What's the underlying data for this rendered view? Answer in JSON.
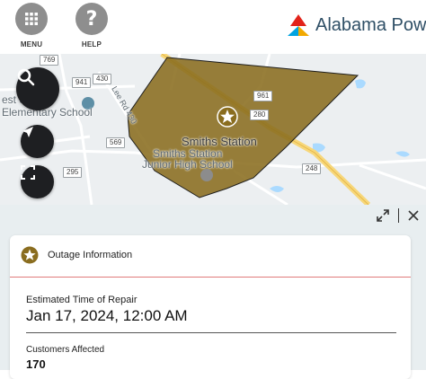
{
  "header": {
    "menu_label": "MENU",
    "help_label": "HELP",
    "help_glyph": "?",
    "brand_name": "Alabama Power",
    "brand_colors": {
      "red": "#e2231a",
      "blue": "#00a3e0",
      "dark": "#2f4f66"
    }
  },
  "map": {
    "places": {
      "school_west_1": "est S",
      "school_west_2": "Elementary School",
      "town": "Smiths Station",
      "jhs_1": "Smiths Station",
      "jhs_2": "Junior High School",
      "road_lee": "Lee Rd 430"
    },
    "route_shields": {
      "r769": "769",
      "r941": "941",
      "r430": "430",
      "r569": "569",
      "r295": "295",
      "r961": "961",
      "r280": "280",
      "r248": "248"
    },
    "outage_fill": "#8a6d1f",
    "outage_icon": "star-icon"
  },
  "map_controls": {
    "search_icon": "search-icon",
    "locate_icon": "locate-arrow-icon",
    "fullscreen_icon": "fullscreen-icon"
  },
  "panel": {
    "expand_icon": "expand-icon",
    "close_icon": "close-icon",
    "card": {
      "title": "Outage Information",
      "etr_label": "Estimated Time of Repair",
      "etr_value": "Jan 17, 2024, 12:00 AM",
      "customers_label": "Customers Affected",
      "customers_value": "170"
    }
  }
}
